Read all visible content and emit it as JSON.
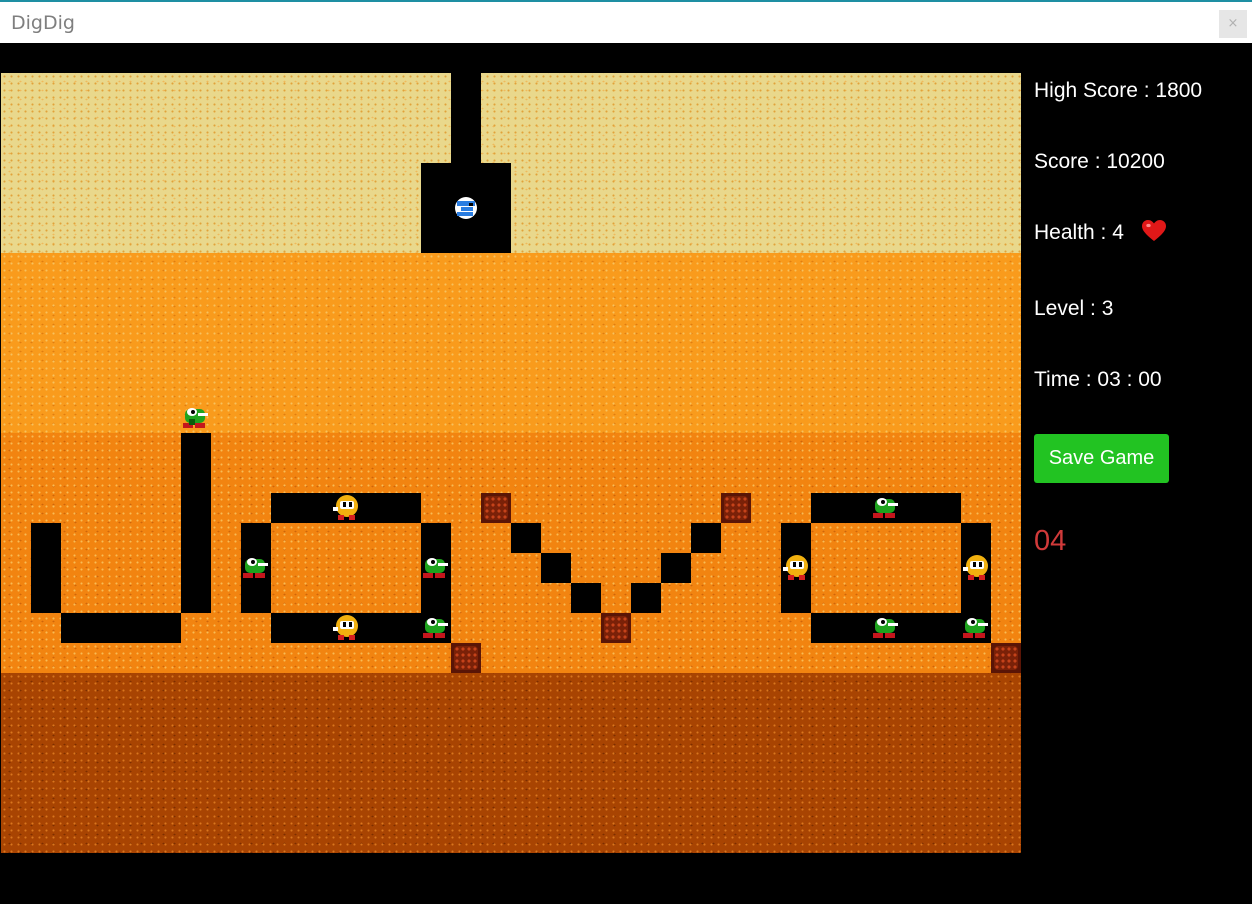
{
  "window": {
    "title": "DigDig",
    "close_label": "×"
  },
  "hud": {
    "high_score": "High Score : 1800",
    "score": "Score : 10200",
    "health": "Health : 4",
    "level": "Level : 3",
    "time": "Time : 03 : 00",
    "save_button": "Save Game",
    "countdown": "04"
  },
  "colors": {
    "save_button": "#22c322",
    "countdown": "#d13a3a",
    "heart": "#e01818",
    "layer_1": "#e9d88c",
    "layer_2": "#f99b1c",
    "layer_3": "#f28410",
    "layer_4": "#a84402"
  },
  "icons": {
    "player": "digger-player-icon",
    "fygar": "fygar-dragon-icon",
    "pooka": "pooka-monster-icon",
    "rock": "rock-icon",
    "health": "heart-icon"
  }
}
